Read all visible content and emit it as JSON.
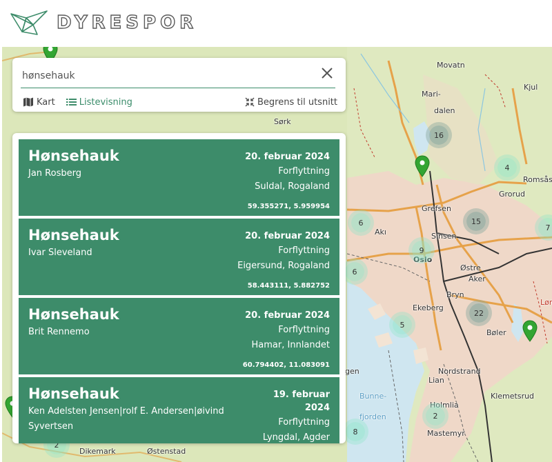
{
  "header": {
    "brand": "DYRESPOR",
    "logo_icon": "origami-bird-icon"
  },
  "search": {
    "value": "hønsehauk",
    "placeholder": "Søk",
    "clear_icon": "close-icon"
  },
  "views": {
    "map_label": "Kart",
    "map_icon": "map-icon",
    "list_label": "Listevisning",
    "list_icon": "list-icon",
    "restrict_label": "Begrens til utsnitt",
    "restrict_icon": "compress-icon"
  },
  "results": [
    {
      "species": "Hønsehauk",
      "observer": "Jan Rosberg",
      "date": "20. februar 2024",
      "type": "Forflyttning",
      "place": "Suldal, Rogaland",
      "coords": "59.355271, 5.959954"
    },
    {
      "species": "Hønsehauk",
      "observer": "Ivar Sleveland",
      "date": "20. februar 2024",
      "type": "Forflyttning",
      "place": "Eigersund, Rogaland",
      "coords": "58.443111, 5.882752"
    },
    {
      "species": "Hønsehauk",
      "observer": "Brit Rennemo",
      "date": "20. februar 2024",
      "type": "Forflyttning",
      "place": "Hamar, Innlandet",
      "coords": "60.794402, 11.083091"
    },
    {
      "species": "Hønsehauk",
      "observer": "Ken Adelsten Jensen|rolf E. Andersen|øivind Syvertsen",
      "date": "19. februar 2024",
      "type": "Forflyttning",
      "place": "Lyngdal, Agder",
      "coords": ""
    }
  ],
  "map": {
    "places": [
      "Movatn",
      "Mari-",
      "dalen",
      "Kjul",
      "Romsås",
      "Grorud",
      "Grefsen",
      "Sinsen",
      "Akı",
      "Oslo",
      "Østre",
      "Aker",
      "Bryn",
      "Ekeberg",
      "Bøler",
      "Nordstrand",
      "Lian",
      "Klemetsrud",
      "Holmlia",
      "Mastemyr",
      "Dikemark",
      "Østenstad",
      "Bunne-",
      "fjorden",
      "gen",
      "Sørk",
      "Løm"
    ],
    "clusters": [
      "16",
      "4",
      "6",
      "15",
      "7",
      "9",
      "6",
      "22",
      "5",
      "2",
      "8",
      "2"
    ],
    "accent_color": "#3d8c6a",
    "pin_color": "#33a532"
  }
}
